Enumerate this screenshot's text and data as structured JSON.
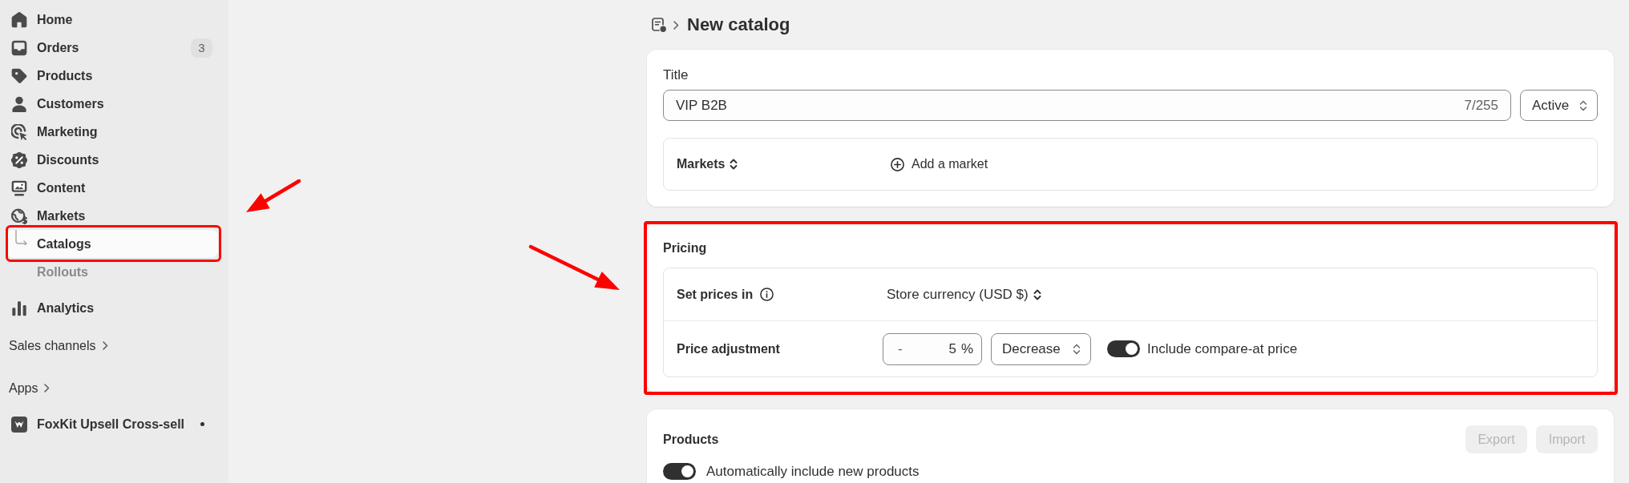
{
  "sidebar": {
    "items": [
      {
        "label": "Home",
        "selected": false
      },
      {
        "label": "Orders",
        "badge": "3",
        "selected": false
      },
      {
        "label": "Products",
        "selected": false
      },
      {
        "label": "Customers",
        "selected": false
      },
      {
        "label": "Marketing",
        "selected": false
      },
      {
        "label": "Discounts",
        "selected": false
      },
      {
        "label": "Content",
        "selected": false
      },
      {
        "label": "Markets",
        "selected": false,
        "children": [
          {
            "label": "Catalogs",
            "selected": true,
            "annotated": true
          },
          {
            "label": "Rollouts",
            "selected": false,
            "annotated": false
          }
        ]
      },
      {
        "label": "Analytics",
        "selected": false
      }
    ],
    "sections": [
      {
        "label": "Sales channels"
      },
      {
        "label": "Apps",
        "items": [
          {
            "label": "FoxKit Upsell Cross-sell",
            "notification": true
          }
        ]
      }
    ]
  },
  "header": {
    "title": "New catalog"
  },
  "catalog": {
    "title_label": "Title",
    "title_value": "VIP B2B",
    "counter": "7/255",
    "status": "Active",
    "markets": {
      "label": "Markets",
      "action": "Add a market"
    }
  },
  "pricing": {
    "heading": "Pricing",
    "annotated": true,
    "set_prices_in": {
      "label": "Set prices in",
      "value": "Store currency (USD $)"
    },
    "price_adjustment": {
      "label": "Price adjustment",
      "sign": "-",
      "amount": "5",
      "unit": "%",
      "direction": "Decrease",
      "compare_at": {
        "label": "Include compare-at price",
        "on": true
      }
    }
  },
  "products": {
    "heading": "Products",
    "buttons": [
      {
        "label": "Export",
        "disabled": true
      },
      {
        "label": "Import",
        "disabled": true
      }
    ],
    "auto_include": {
      "label": "Automatically include new products",
      "on": true
    }
  }
}
